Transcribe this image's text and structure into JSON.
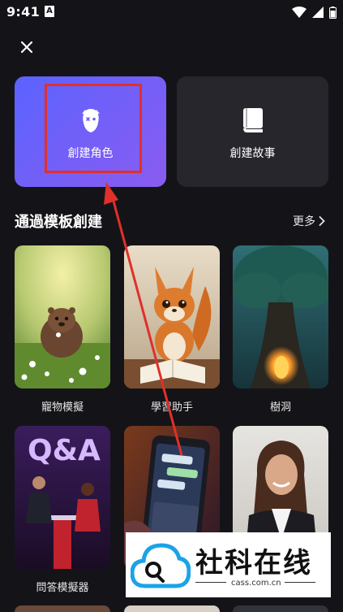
{
  "status_bar": {
    "time": "9:41",
    "notification_badge": "A"
  },
  "top_cards": {
    "create_character": "創建角色",
    "create_story": "創建故事"
  },
  "section": {
    "title": "通過模板創建",
    "more_label": "更多"
  },
  "templates": [
    {
      "label": "寵物模擬"
    },
    {
      "label": "學習助手"
    },
    {
      "label": "樹洞"
    },
    {
      "label": "問答模擬器"
    }
  ],
  "tile_text": {
    "qa_sign": "Q&A"
  },
  "watermark": {
    "title": "社科在线",
    "url": "cass.com.cn"
  },
  "colors": {
    "accent_gradient_start": "#5b63ff",
    "accent_gradient_end": "#8a5cf0",
    "highlight": "#e0302a",
    "background": "#141418"
  }
}
